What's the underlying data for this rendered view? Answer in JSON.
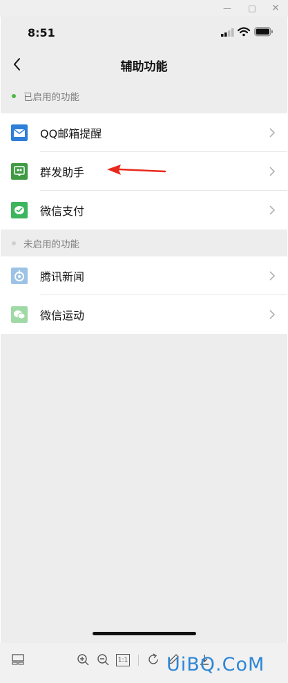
{
  "window": {
    "min_icon": "minimize-icon",
    "max_icon": "maximize-icon",
    "close_icon": "close-icon"
  },
  "status_bar": {
    "time": "8:51",
    "signal_icon": "cellular-signal-icon",
    "wifi_icon": "wifi-icon",
    "battery_icon": "battery-icon"
  },
  "nav": {
    "title": "辅助功能",
    "back_icon": "back-chevron-icon"
  },
  "sections": [
    {
      "title": "已启用的功能",
      "dot_color": "#4fb848",
      "items": [
        {
          "label": "QQ邮箱提醒",
          "icon": "qq-mail-icon",
          "color": "#2e7fd8"
        },
        {
          "label": "群发助手",
          "icon": "group-message-icon",
          "color": "#3f9a43"
        },
        {
          "label": "微信支付",
          "icon": "wechat-pay-icon",
          "color": "#3cb55c"
        }
      ]
    },
    {
      "title": "未启用的功能",
      "dot_color": "#cfcfcf",
      "items": [
        {
          "label": "腾讯新闻",
          "icon": "tencent-news-icon",
          "color": "#9cc3e6"
        },
        {
          "label": "微信运动",
          "icon": "wechat-sport-icon",
          "color": "#9fd9a5"
        }
      ]
    }
  ],
  "annotation": {
    "arrow_color": "#e8291d",
    "icon": "red-arrow-annotation"
  },
  "viewer_toolbar": {
    "buttons": [
      "thumbnail-icon",
      "zoom-in-icon",
      "zoom-out-icon",
      "actual-size-icon",
      "rotate-icon",
      "edit-pen-icon",
      "download-icon"
    ],
    "actual_size_label": "1:1"
  },
  "watermark": "UiBQ.CoM"
}
